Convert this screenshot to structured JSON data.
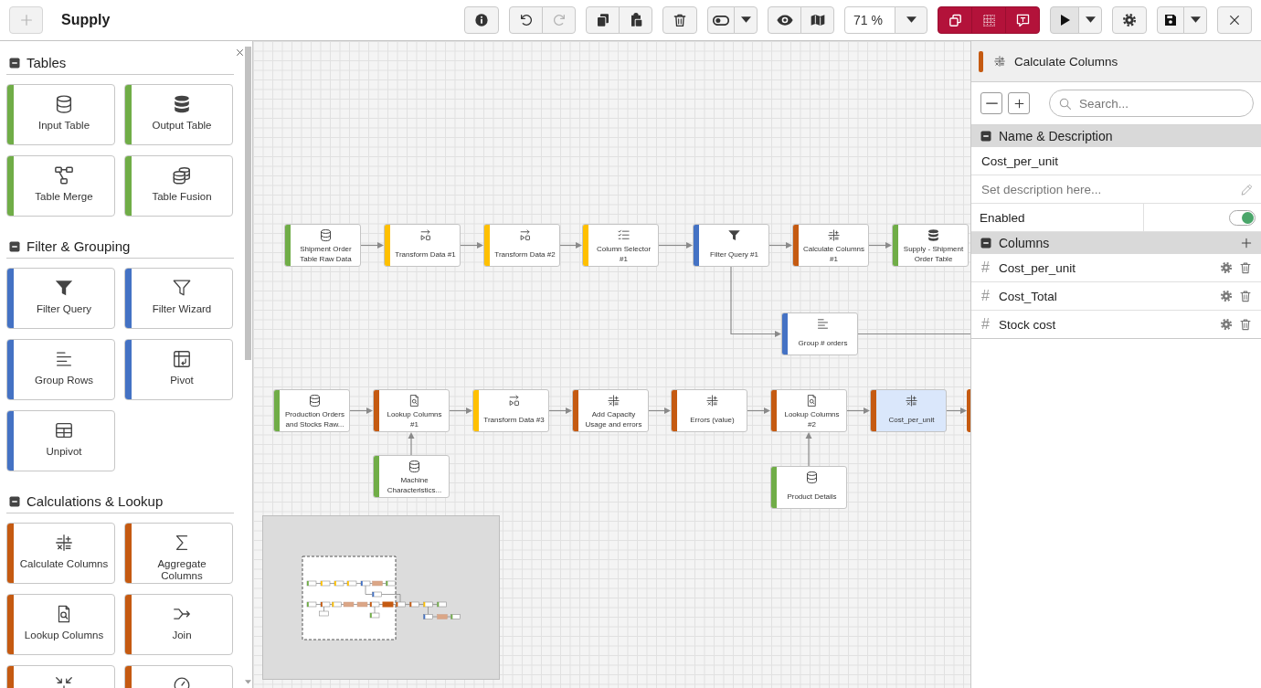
{
  "app_bar": {
    "add_button": {
      "disabled": true
    },
    "title": "Supply"
  },
  "toolbar": {
    "groups": [
      {
        "items": [
          {
            "kind": "info",
            "disabled": false
          }
        ]
      },
      {
        "items": [
          {
            "kind": "undo",
            "disabled": false
          },
          {
            "kind": "redo",
            "disabled": true
          }
        ]
      },
      {
        "items": [
          {
            "kind": "copy",
            "disabled": false
          },
          {
            "kind": "paste",
            "disabled": false
          }
        ]
      },
      {
        "items": [
          {
            "kind": "delete",
            "disabled": false
          }
        ]
      },
      {
        "items": [
          {
            "kind": "toggle",
            "disabled": false
          },
          {
            "kind": "dropdown",
            "disabled": false
          }
        ]
      },
      {
        "items": [
          {
            "kind": "view",
            "disabled": false
          },
          {
            "kind": "map",
            "disabled": false
          }
        ]
      },
      {
        "items": [
          {
            "kind": "zoom",
            "value": "71 %",
            "disabled": false
          },
          {
            "kind": "dropdown",
            "disabled": false
          }
        ]
      },
      {
        "items": [
          {
            "kind": "windows",
            "disabled": false
          },
          {
            "kind": "grid",
            "disabled": false
          },
          {
            "kind": "comment",
            "disabled": false
          }
        ]
      },
      {
        "items": [
          {
            "kind": "run",
            "disabled": false
          },
          {
            "kind": "dropdown",
            "disabled": false
          }
        ]
      },
      {
        "items": [
          {
            "kind": "settings",
            "disabled": false
          }
        ]
      },
      {
        "items": [
          {
            "kind": "save",
            "disabled": false
          },
          {
            "kind": "dropdown",
            "disabled": false
          }
        ]
      },
      {
        "items": [
          {
            "kind": "close",
            "disabled": false
          }
        ]
      }
    ]
  },
  "palette": {
    "sections": [
      {
        "title": "Tables",
        "expanded": true,
        "color": "#70ad47",
        "items": [
          {
            "label": "Input Table",
            "kind": "input"
          },
          {
            "label": "Output Table",
            "kind": "output"
          },
          {
            "label": "Table Merge",
            "kind": "merge"
          },
          {
            "label": "Table Fusion",
            "kind": "fusion"
          }
        ]
      },
      {
        "title": "Filter & Grouping",
        "expanded": true,
        "color": "#4472c4",
        "items": [
          {
            "label": "Filter Query",
            "kind": "filter"
          },
          {
            "label": "Filter Wizard",
            "kind": "wizard"
          },
          {
            "label": "Group Rows",
            "kind": "group"
          },
          {
            "label": "Pivot",
            "kind": "pivot"
          },
          {
            "label": "Unpivot",
            "kind": "unpivot"
          }
        ]
      },
      {
        "title": "Calculations & Lookup",
        "expanded": true,
        "color": "#c55a11",
        "items": [
          {
            "label": "Calculate Columns",
            "kind": "calculate"
          },
          {
            "label": "Aggregate Columns",
            "kind": "aggregate"
          },
          {
            "label": "Lookup Columns",
            "kind": "lookup"
          },
          {
            "label": "Join",
            "kind": "join"
          },
          {
            "kind": "converge"
          },
          {
            "kind": "dial"
          }
        ]
      }
    ]
  },
  "canvas": {
    "nodes": [
      {
        "label": "Shipment Order Table Raw Data",
        "kind": "input",
        "color": "#70ad47",
        "selected": false
      },
      {
        "label": "Transform Data #1",
        "kind": "transform",
        "color": "#ffc000",
        "selected": false
      },
      {
        "label": "Transform Data #2",
        "kind": "transform",
        "color": "#ffc000",
        "selected": false
      },
      {
        "label": "Column Selector #1",
        "kind": "select",
        "color": "#ffc000",
        "selected": false
      },
      {
        "label": "Filter Query #1",
        "kind": "filter",
        "color": "#4472c4",
        "selected": false
      },
      {
        "label": "Calculate Columns #1",
        "kind": "calculate",
        "color": "#c55a11",
        "selected": false
      },
      {
        "label": "Supply - Shipment Order Table",
        "kind": "output",
        "color": "#70ad47",
        "selected": false
      },
      {
        "label": "Group # orders",
        "kind": "group",
        "color": "#4472c4",
        "selected": false
      },
      {
        "label": "Production Orders and Stocks Raw...",
        "kind": "input",
        "color": "#70ad47",
        "selected": false
      },
      {
        "label": "Lookup Columns #1",
        "kind": "lookup",
        "color": "#c55a11",
        "selected": false
      },
      {
        "label": "Machine Characteristics...",
        "kind": "input",
        "color": "#70ad47",
        "selected": false
      },
      {
        "label": "Transform Data #3",
        "kind": "transform",
        "color": "#ffc000",
        "selected": false
      },
      {
        "label": "Add Capacity Usage and errors",
        "kind": "calculate",
        "color": "#c55a11",
        "selected": false
      },
      {
        "label": "Errors (value)",
        "kind": "calculate",
        "color": "#c55a11",
        "selected": false
      },
      {
        "label": "Lookup Columns #2",
        "kind": "lookup",
        "color": "#c55a11",
        "selected": false
      },
      {
        "label": "Product Details",
        "kind": "input",
        "color": "#70ad47",
        "selected": false
      },
      {
        "label": "Cost_per_unit",
        "kind": "calculate",
        "color": "#c55a11",
        "selected": true
      }
    ],
    "partial_node": {
      "color": "#c55a11"
    }
  },
  "properties_panel": {
    "node": {
      "title": "Calculate Columns",
      "kind": "calculate",
      "color": "#c55a11"
    },
    "search": {
      "placeholder": "Search..."
    },
    "sections": [
      {
        "kind": "details",
        "title": "Name & Description",
        "expanded": true,
        "name": {
          "value": "Cost_per_unit"
        },
        "description": {
          "placeholder": "Set description here..."
        },
        "enabled": {
          "label": "Enabled",
          "on": true
        }
      },
      {
        "kind": "columns",
        "title": "Columns",
        "expanded": true,
        "rows": [
          {
            "type_symbol": "#",
            "name": "Cost_per_unit"
          },
          {
            "type_symbol": "#",
            "name": "Cost_Total"
          },
          {
            "type_symbol": "#",
            "name": "Stock cost"
          }
        ]
      }
    ]
  }
}
